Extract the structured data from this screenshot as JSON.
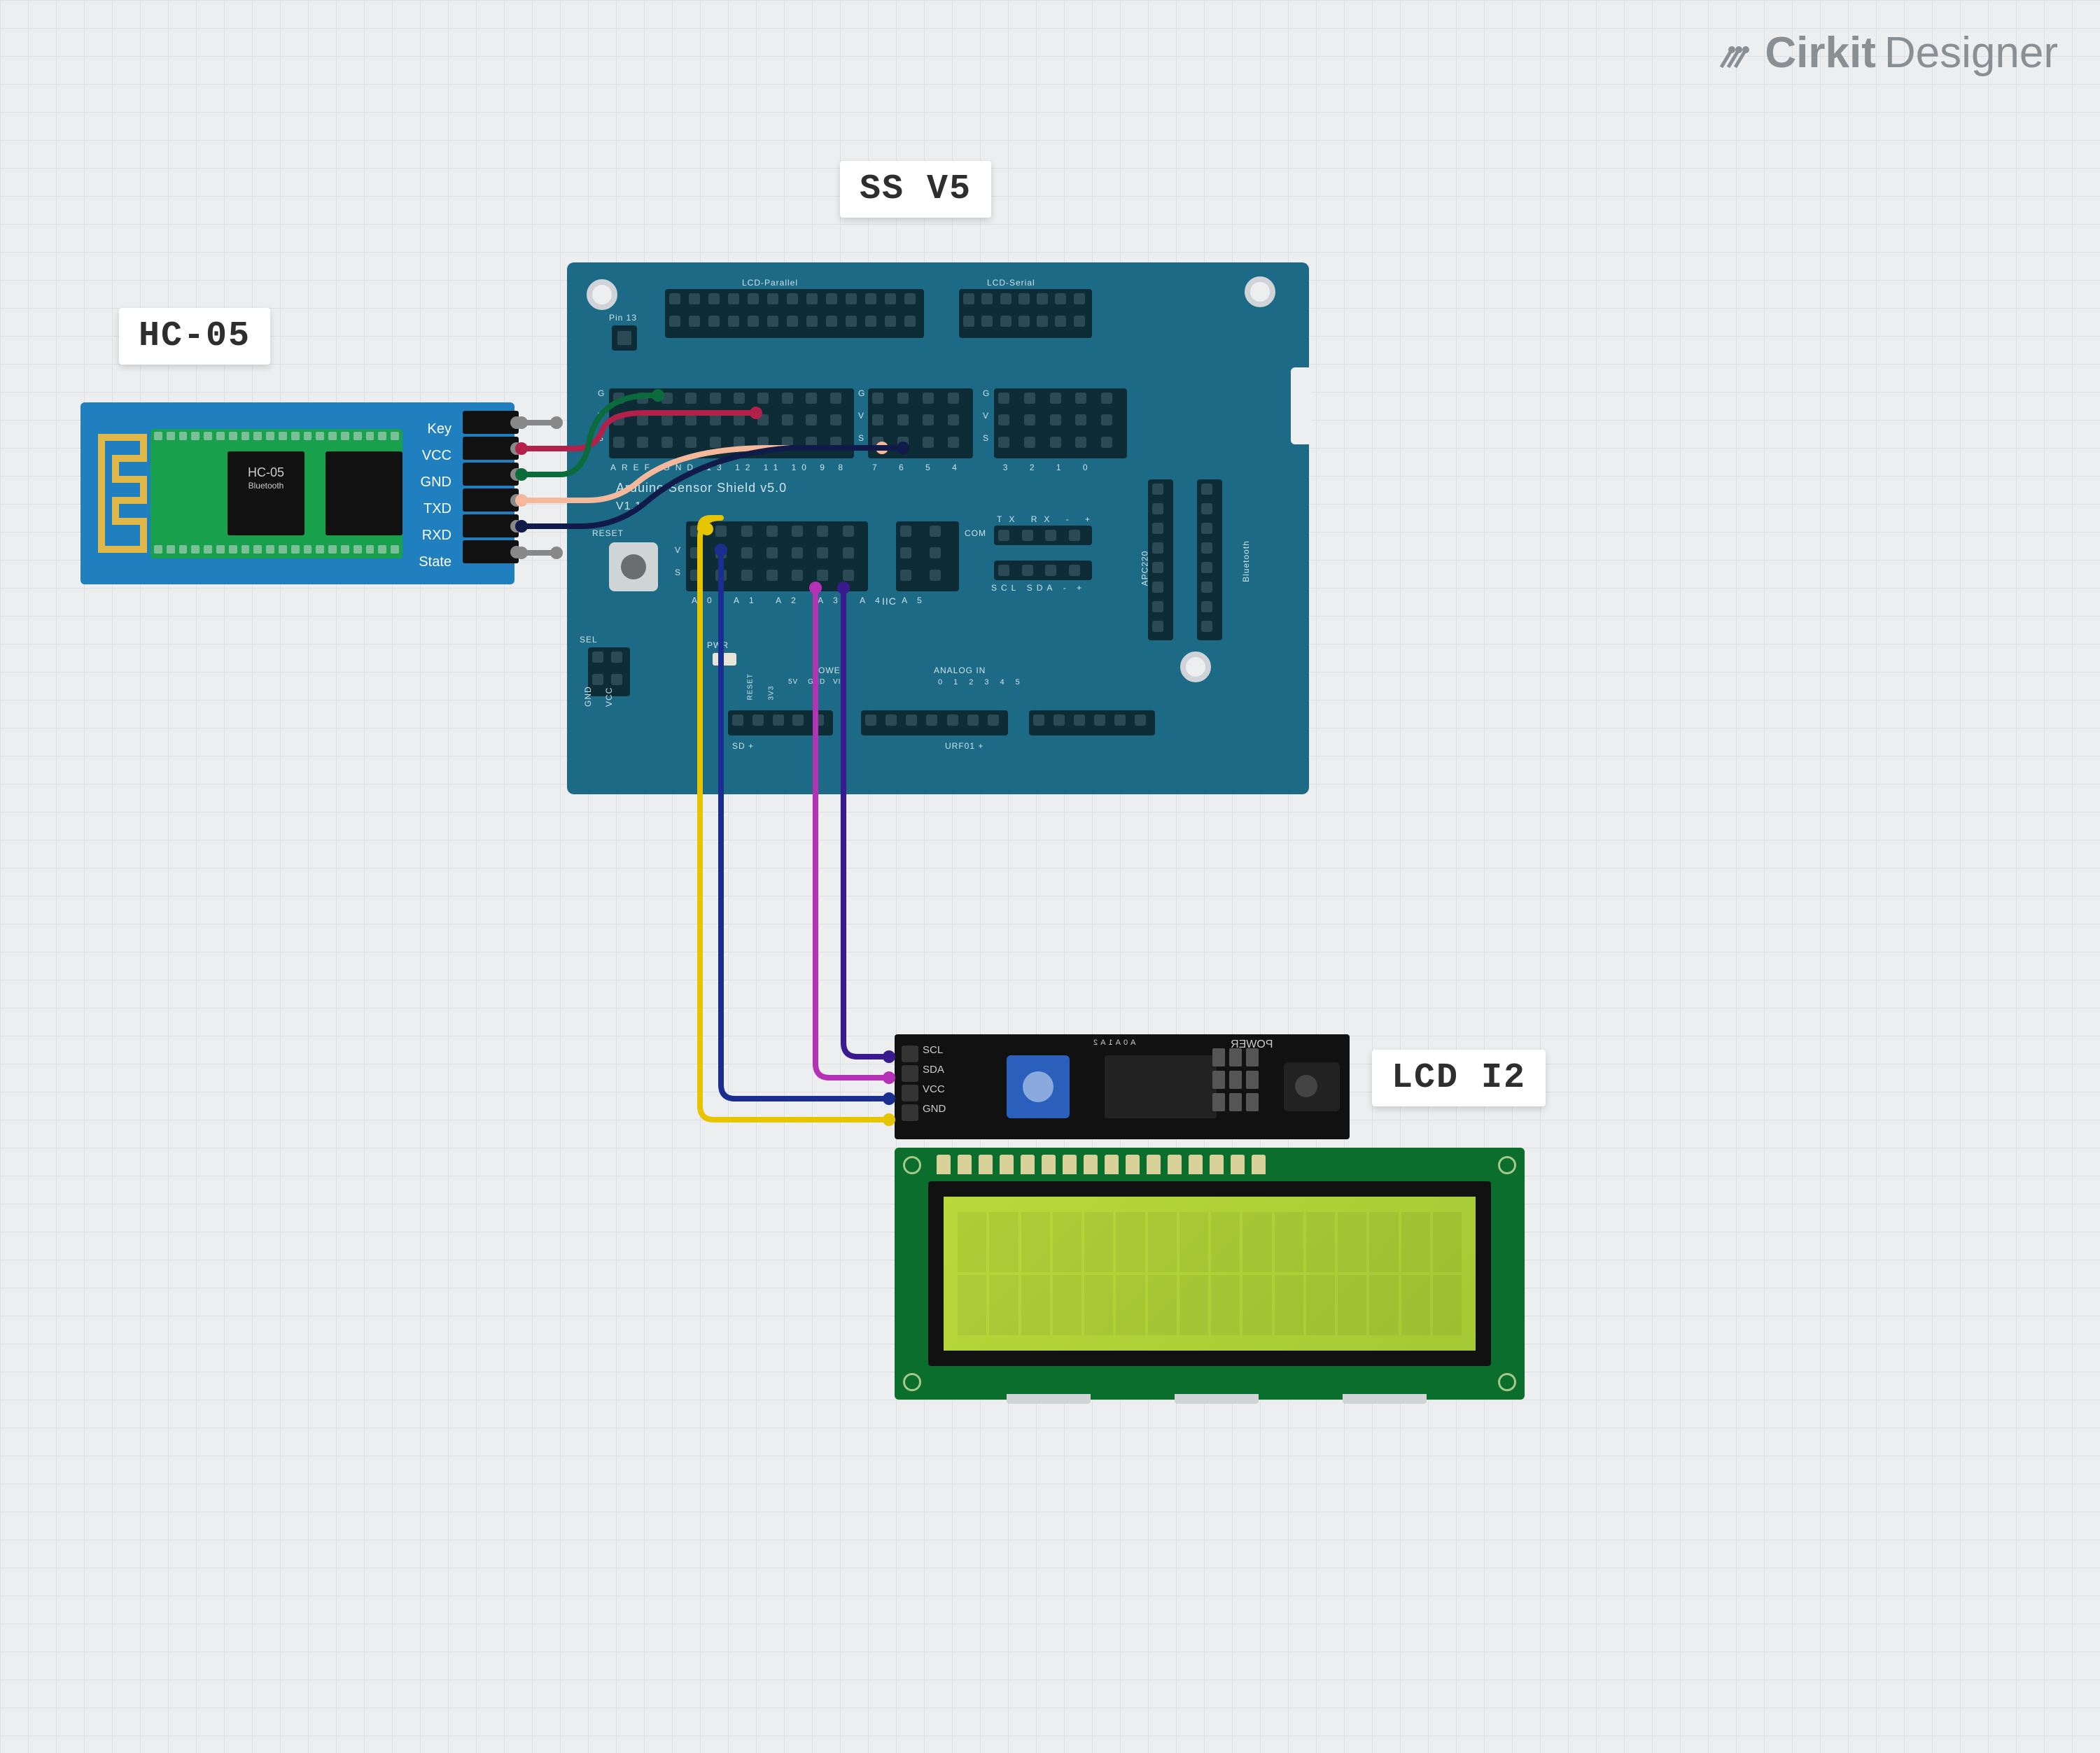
{
  "brand": {
    "name1": "Cirkit",
    "name2": "Designer"
  },
  "components": {
    "hc05": {
      "label": "HC-05",
      "chip_text1": "HC-05",
      "chip_text2": "Bluetooth",
      "pins": [
        "Key",
        "VCC",
        "GND",
        "TXD",
        "RXD",
        "State"
      ]
    },
    "shield": {
      "label": "SS V5",
      "lcd_parallel": "LCD-Parallel",
      "lcd_serial": "LCD-Serial",
      "pin13": "Pin 13",
      "gvs_g": "G",
      "gvs_v": "V",
      "gvs_s": "S",
      "aref_row": [
        "AREF",
        "GND",
        "13",
        "12",
        "11",
        "10",
        "9",
        "8"
      ],
      "digital_row": [
        "7",
        "6",
        "5",
        "4",
        "3",
        "2",
        "1",
        "0"
      ],
      "title_line": "Arduino Sensor Shield v5.0",
      "version": "V1.1",
      "reset": "RESET",
      "analog_labels": [
        "A0",
        "A1",
        "A2",
        "A3",
        "A4",
        "A5"
      ],
      "iic": "IIC",
      "com": "COM",
      "com_sub": [
        "TX",
        "RX",
        "-",
        "+"
      ],
      "iic_sub": [
        "SCL",
        "SDA",
        "-",
        "+"
      ],
      "apc220": "APC220",
      "bluetooth": "Bluetooth",
      "sel": "SEL",
      "sel_pins": [
        "GND",
        "VCC"
      ],
      "pwr": "PWR",
      "power_group": "POWER",
      "power_pins": [
        "RESET",
        "3V3",
        "5V",
        "GND",
        "VIN"
      ],
      "analog_in": "ANALOG IN",
      "analog_in_pins": [
        "0",
        "1",
        "2",
        "3",
        "4",
        "5"
      ],
      "sd": "SD +",
      "urf": "URF01 +"
    },
    "lcd": {
      "label": "LCD I2",
      "pins": [
        "GND",
        "VCC",
        "SDA",
        "SCL"
      ],
      "silk": [
        "A0",
        "A1",
        "A2"
      ],
      "power": "POWER"
    }
  },
  "wires": [
    {
      "id": "hc05-key-unused",
      "color": "#888888",
      "from": "HC-05.Key",
      "to": "(unconnected)"
    },
    {
      "id": "hc05-vcc",
      "color": "#b3204a",
      "from": "HC-05.VCC",
      "to": "SSV5.V(9)"
    },
    {
      "id": "hc05-gnd",
      "color": "#0b6b3d",
      "from": "HC-05.GND",
      "to": "SSV5.G(13)"
    },
    {
      "id": "hc05-txd",
      "color": "#f6b89a",
      "from": "HC-05.TXD",
      "to": "SSV5.S(8)"
    },
    {
      "id": "hc05-rxd",
      "color": "#101b4a",
      "from": "HC-05.RXD",
      "to": "SSV5.S(7)"
    },
    {
      "id": "hc05-state-unused",
      "color": "#888888",
      "from": "HC-05.State",
      "to": "(unconnected)"
    },
    {
      "id": "lcd-gnd",
      "color": "#e6c400",
      "from": "LCD.GND",
      "to": "SSV5.Analog.G(A0)"
    },
    {
      "id": "lcd-vcc",
      "color": "#1a2e8f",
      "from": "LCD.VCC",
      "to": "SSV5.Analog.V(A0)"
    },
    {
      "id": "lcd-sda",
      "color": "#b531b5",
      "from": "LCD.SDA",
      "to": "SSV5.Analog.S(A4)"
    },
    {
      "id": "lcd-scl",
      "color": "#3a1a8f",
      "from": "LCD.SCL",
      "to": "SSV5.Analog.S(A5)"
    }
  ]
}
